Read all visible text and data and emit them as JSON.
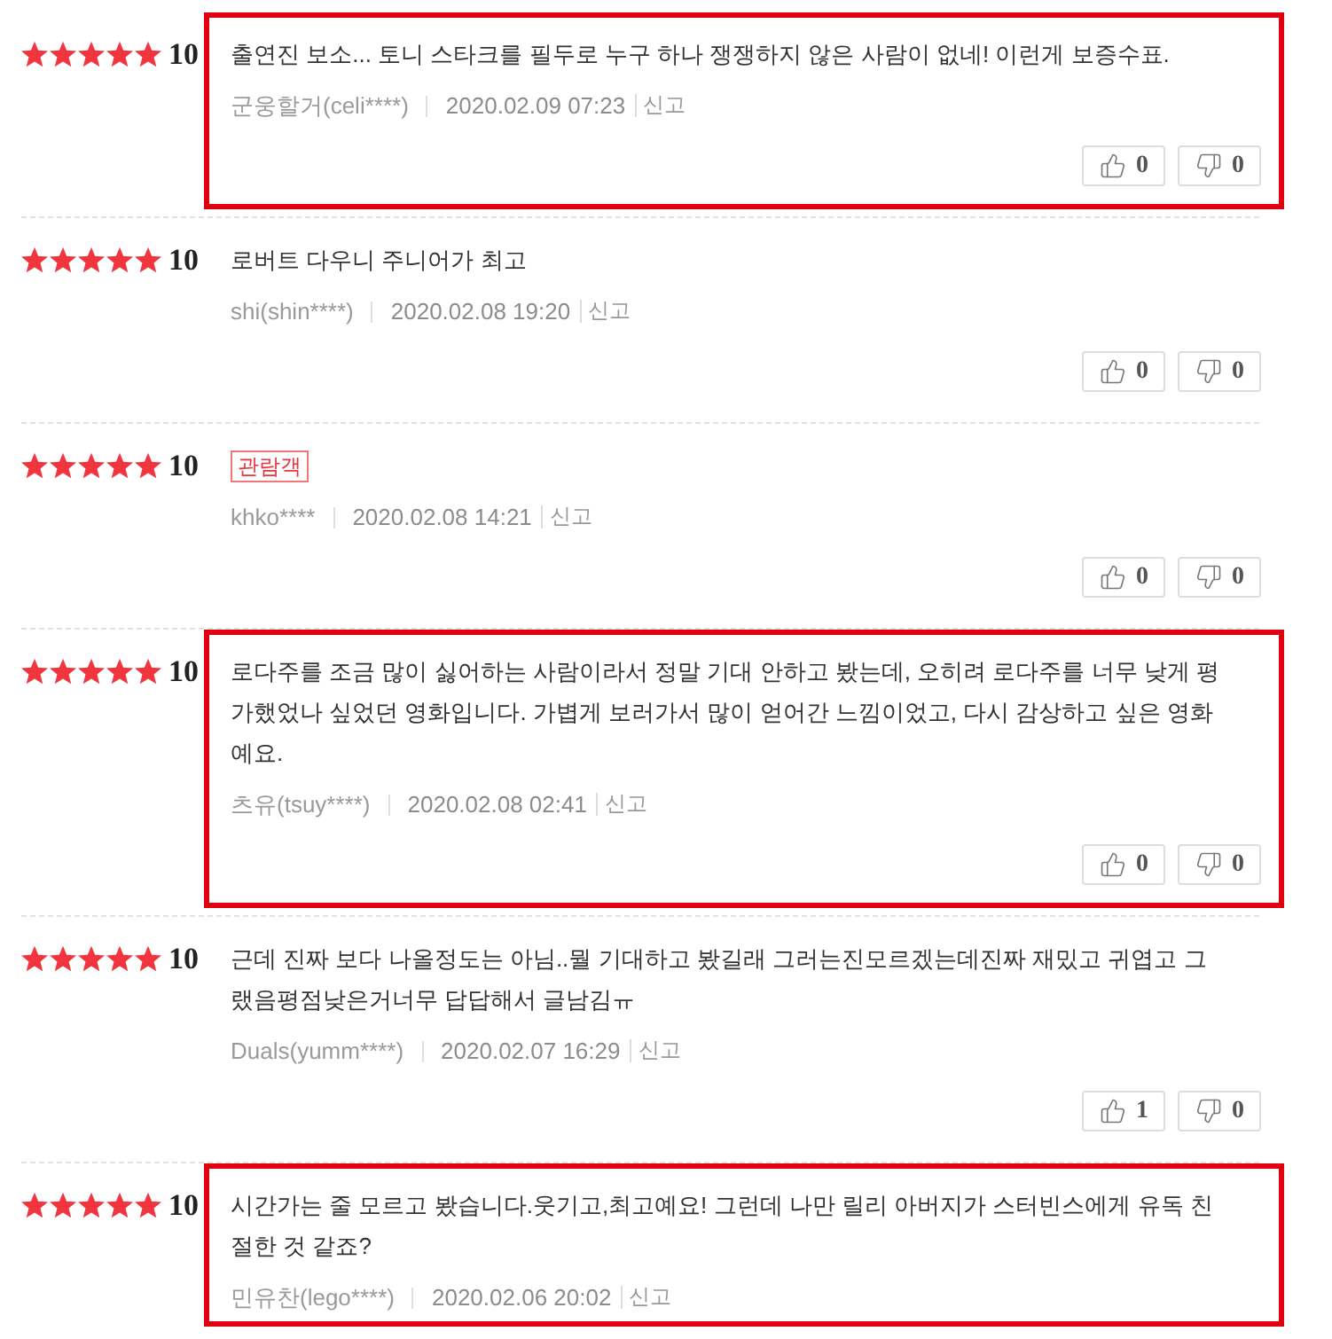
{
  "reviews": [
    {
      "stars": 5,
      "score": "10",
      "highlighted": true,
      "text": "출연진 보소... 토니 스타크를 필두로 누구 하나 쟁쟁하지 않은 사람이 없네! 이런게 보증수표.",
      "author": "군웅할거(celi****)",
      "date": "2020.02.09 07:23",
      "report": "신고",
      "votes": {
        "up": "0",
        "down": "0"
      }
    },
    {
      "stars": 5,
      "score": "10",
      "highlighted": false,
      "text": "로버트 다우니 주니어가 최고",
      "author": "shi(shin****)",
      "date": "2020.02.08 19:20",
      "report": "신고",
      "votes": {
        "up": "0",
        "down": "0"
      }
    },
    {
      "stars": 5,
      "score": "10",
      "highlighted": false,
      "badge": "관람객",
      "author": "khko****",
      "date": "2020.02.08 14:21",
      "report": "신고",
      "votes": {
        "up": "0",
        "down": "0"
      }
    },
    {
      "stars": 5,
      "score": "10",
      "highlighted": true,
      "text": "로다주를 조금 많이 싫어하는 사람이라서 정말 기대 안하고 봤는데, 오히려 로다주를 너무 낮게 평가했었나 싶었던 영화입니다. 가볍게 보러가서 많이 얻어간 느낌이었고, 다시 감상하고 싶은 영화예요.",
      "author": "츠유(tsuy****)",
      "date": "2020.02.08 02:41",
      "report": "신고",
      "votes": {
        "up": "0",
        "down": "0"
      }
    },
    {
      "stars": 5,
      "score": "10",
      "highlighted": false,
      "text": "근데 진짜 보다 나올정도는 아님..뭘 기대하고 봤길래 그러는진모르겠는데진짜 재밌고 귀엽고 그랬음평점낮은거너무 답답해서 글남김ㅠ",
      "author": "Duals(yumm****)",
      "date": "2020.02.07 16:29",
      "report": "신고",
      "votes": {
        "up": "1",
        "down": "0"
      }
    },
    {
      "stars": 5,
      "score": "10",
      "highlighted": true,
      "text": "시간가는 줄 모르고 봤습니다.웃기고,최고예요! 그런데 나만 릴리 아버지가 스터빈스에게 유독 친절한 것 같죠?",
      "author": "민유찬(lego****)",
      "date": "2020.02.06 20:02",
      "report": "신고"
    }
  ]
}
